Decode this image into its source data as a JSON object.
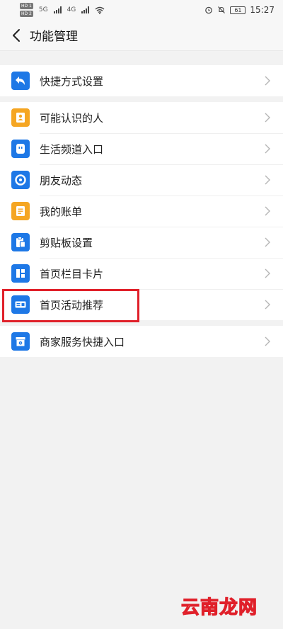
{
  "status_bar": {
    "sim1": "HD 1",
    "sim2": "HD 2",
    "net1": "5G",
    "net2": "4G",
    "battery": "61",
    "time": "15:27"
  },
  "header": {
    "title": "功能管理"
  },
  "groups": [
    {
      "items": [
        {
          "label": "快捷方式设置",
          "icon": "back-arrow-icon",
          "color": "#1e78e6"
        }
      ]
    },
    {
      "items": [
        {
          "label": "可能认识的人",
          "icon": "contacts-icon",
          "color": "#f5a623"
        },
        {
          "label": "生活频道入口",
          "icon": "life-channel-icon",
          "color": "#1e78e6"
        },
        {
          "label": "朋友动态",
          "icon": "moments-aperture-icon",
          "color": "#1e78e6"
        },
        {
          "label": "我的账单",
          "icon": "bill-icon",
          "color": "#f5a623"
        },
        {
          "label": "剪贴板设置",
          "icon": "clipboard-icon",
          "color": "#1e78e6"
        },
        {
          "label": "首页栏目卡片",
          "icon": "grid-cards-icon",
          "color": "#1e78e6"
        },
        {
          "label": "首页活动推荐",
          "icon": "card-promo-icon",
          "color": "#1e78e6"
        }
      ]
    },
    {
      "items": [
        {
          "label": "商家服务快捷入口",
          "icon": "shop-icon",
          "color": "#1e78e6"
        }
      ]
    }
  ],
  "highlight_color": "#e0202a",
  "watermark": "云南龙网"
}
